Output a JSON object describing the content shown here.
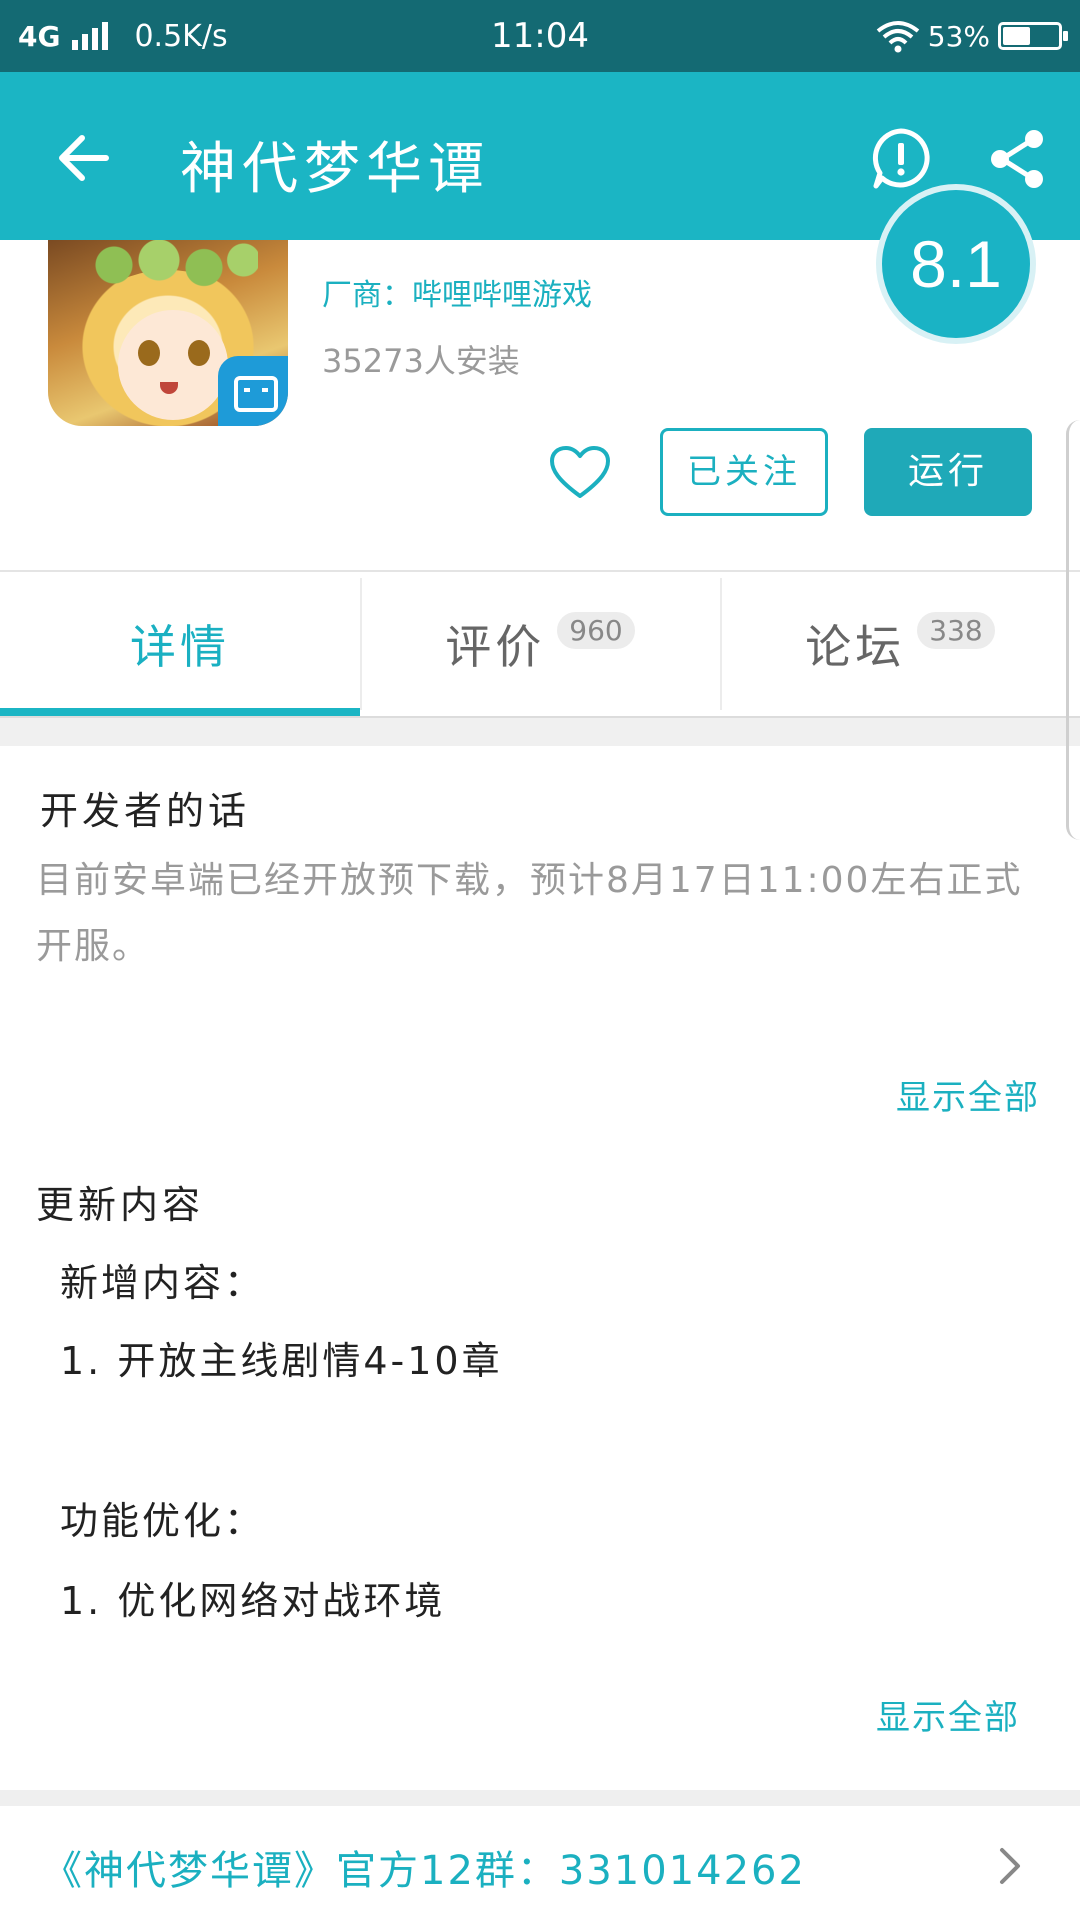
{
  "status_bar": {
    "network": "4G",
    "speed": "0.5K/s",
    "time": "11:04",
    "battery_pct": "53%",
    "battery_level": 0.53
  },
  "app_bar": {
    "title": "神代梦华谭",
    "icons": [
      "back-arrow-icon",
      "report-icon",
      "share-icon"
    ]
  },
  "app_info": {
    "vendor": "厂商：哔哩哔哩游戏",
    "installs": "35273人安装",
    "score": "8.1",
    "followed_label": "已关注",
    "run_label": "运行"
  },
  "tabs": [
    {
      "label": "详情",
      "count": ""
    },
    {
      "label": "评价",
      "count": "960"
    },
    {
      "label": "论坛",
      "count": "338"
    }
  ],
  "developer": {
    "title": "开发者的话",
    "text": "目前安卓端已经开放预下载，预计8月17日11:00左右正式开服。",
    "show_all": "显示全部"
  },
  "updates": {
    "title": "更新内容",
    "lines": [
      "新增内容：",
      "1. 开放主线剧情4-10章",
      "功能优化：",
      "1. 优化网络对战环境"
    ],
    "show_all": "显示全部"
  },
  "group": {
    "text": "《神代梦华谭》官方12群：331014262"
  },
  "colors": {
    "status_bar": "#146a73",
    "app_bar": "#1bb5c4",
    "accent": "#1bb0c0",
    "run_button": "#1fa9b8"
  }
}
